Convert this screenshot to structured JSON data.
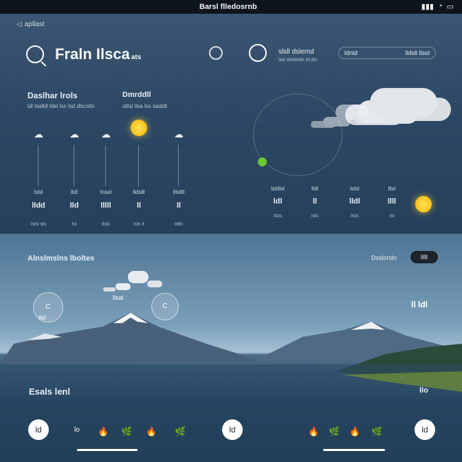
{
  "status_bar": {
    "title": "Barsl flledosrnb",
    "icons": [
      "signal-icon",
      "wifi-icon",
      "battery-icon"
    ]
  },
  "header": {
    "back_label": "apllast",
    "app_name": "Fraln Ilsca",
    "app_name_suffix": "ats",
    "location": {
      "title": "slsll dslemd",
      "subtitle": "lad sllslfedls ld dls"
    },
    "search": {
      "left": "ldnld",
      "right": "lldsll llsol"
    }
  },
  "hourly_section": {
    "title": "Daslhar lrols",
    "subtitle": "ldl lsalkll ldel lsn lsd dlscslln",
    "side_title": "Dmrddll",
    "side_subtitle": "sltlsl llsa lss saddll",
    "items": [
      {
        "icon": "rain-cloud-icon",
        "label": "lslsl",
        "value": "lldd",
        "foot": "lslsl sls"
      },
      {
        "icon": "rain-cloud-icon",
        "label": "lldl",
        "value": "lld",
        "foot": "lsl"
      },
      {
        "icon": "cloud-icon",
        "label": "lnsel",
        "value": "lllll",
        "foot": "llsls"
      },
      {
        "icon": "sun-icon",
        "label": "lldslll",
        "value": "ll",
        "foot": "lsls ll"
      },
      {
        "icon": "rain-cloud-icon",
        "label": "lllsllll",
        "value": "ll",
        "foot": "ldlls"
      }
    ]
  },
  "daily_section": {
    "items": [
      {
        "label": "lsldlsl",
        "value": "ldl",
        "foot": "llsls"
      },
      {
        "label": "lldl",
        "value": "ll",
        "foot": "lsls"
      },
      {
        "label": "lslsl",
        "value": "lldl",
        "foot": "llsls"
      },
      {
        "label": "lllsl",
        "value": "llll",
        "foot": "lsl"
      }
    ]
  },
  "landscape": {
    "title": "Alnslmslns lboltes",
    "label": "Dsslorsln",
    "toggle": "lllll",
    "bubbles": [
      {
        "icon": "c-icon",
        "caption": "llsl"
      },
      {
        "icon": "c-icon",
        "caption": ""
      }
    ],
    "cloud_caption": "llsal",
    "corner_value": "ll ldl",
    "bottom_title": "Esals lenl",
    "bottom_right": "llo"
  },
  "bottom_nav": {
    "buttons": [
      "ld",
      "ld",
      "ld"
    ],
    "icons_left": [
      "lo",
      "🔥",
      "🌿",
      "🔥",
      "🌿"
    ],
    "icons_right": [
      "🔥",
      "🌿",
      "🔥",
      "🌿"
    ]
  },
  "colors": {
    "accent_sun": "#f5b400",
    "accent_green": "#6ccb2c",
    "panel": "#2c4864"
  }
}
